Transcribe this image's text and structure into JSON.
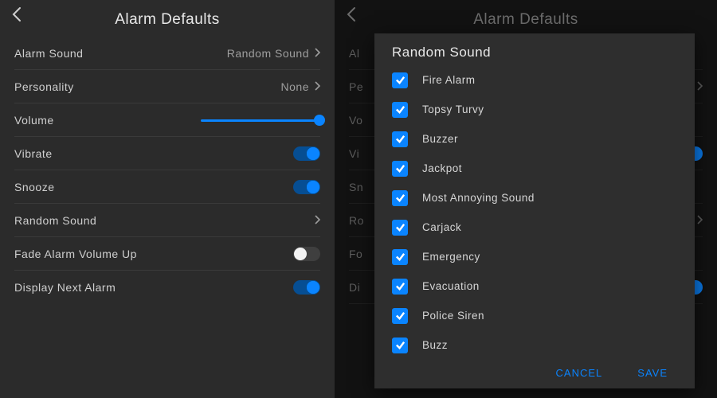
{
  "header_title": "Alarm Defaults",
  "left": {
    "alarm_sound": {
      "label": "Alarm Sound",
      "value": "Random Sound"
    },
    "personality": {
      "label": "Personality",
      "value": "None"
    },
    "volume": {
      "label": "Volume"
    },
    "vibrate": {
      "label": "Vibrate",
      "on": true
    },
    "snooze": {
      "label": "Snooze",
      "on": true
    },
    "random_sound": {
      "label": "Random Sound"
    },
    "fade_up": {
      "label": "Fade Alarm Volume Up",
      "on": false
    },
    "display_next": {
      "label": "Display Next Alarm",
      "on": true
    }
  },
  "bg": {
    "rows": [
      {
        "label": "Al"
      },
      {
        "label": "Pe"
      },
      {
        "label": "Vo"
      },
      {
        "label": "Vi"
      },
      {
        "label": "Sn"
      },
      {
        "label": "Ro"
      },
      {
        "label": "Fo"
      },
      {
        "label": "Di"
      }
    ]
  },
  "modal": {
    "title": "Random Sound",
    "items": [
      "Fire Alarm",
      "Topsy Turvy",
      "Buzzer",
      "Jackpot",
      "Most Annoying Sound",
      "Carjack",
      "Emergency",
      "Evacuation",
      "Police Siren",
      "Buzz"
    ],
    "cancel": "CANCEL",
    "save": "SAVE"
  }
}
